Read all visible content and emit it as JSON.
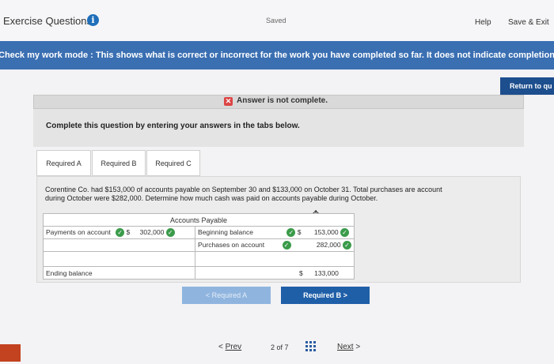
{
  "header": {
    "title": "Exercise Questions",
    "info_icon": "info-icon",
    "saved": "Saved",
    "help": "Help",
    "save_exit": "Save & Exit"
  },
  "banner": {
    "text": "Check my work mode : This shows what is correct or incorrect for the work you have completed so far. It does not indicate completion."
  },
  "return_button": "Return to qu",
  "answer_status": "Answer is not complete.",
  "instructions": "Complete this question by entering your answers in the tabs below.",
  "tabs": [
    {
      "label": "Required A"
    },
    {
      "label": "Required B"
    },
    {
      "label": "Required C"
    }
  ],
  "question": {
    "line1": "Corentine Co. had $153,000 of accounts payable on September 30 and $133,000 on October 31. Total purchases are account",
    "line2": "during October were $282,000. Determine how much cash was paid on accounts payable during October."
  },
  "t_account": {
    "title": "Accounts Payable",
    "debit_label": "Payments on account",
    "debit_currency": "$",
    "debit_value": "302,000",
    "credit_rows": [
      {
        "label": "Beginning balance",
        "currency": "$",
        "value": "153,000"
      },
      {
        "label": "Purchases on account",
        "currency": "",
        "value": "282,000"
      }
    ],
    "ending_label": "Ending balance",
    "ending_currency": "$",
    "ending_value": "133,000"
  },
  "nav_buttons": {
    "prev_required": "< Required A",
    "next_required": "Required B >"
  },
  "pager": {
    "prev": "Prev",
    "page": "2 of 7",
    "next": "Next"
  },
  "colors": {
    "banner": "#3a6fb2",
    "primary_button": "#1f5fa8",
    "check": "#3a9b4a",
    "error": "#d44444"
  }
}
